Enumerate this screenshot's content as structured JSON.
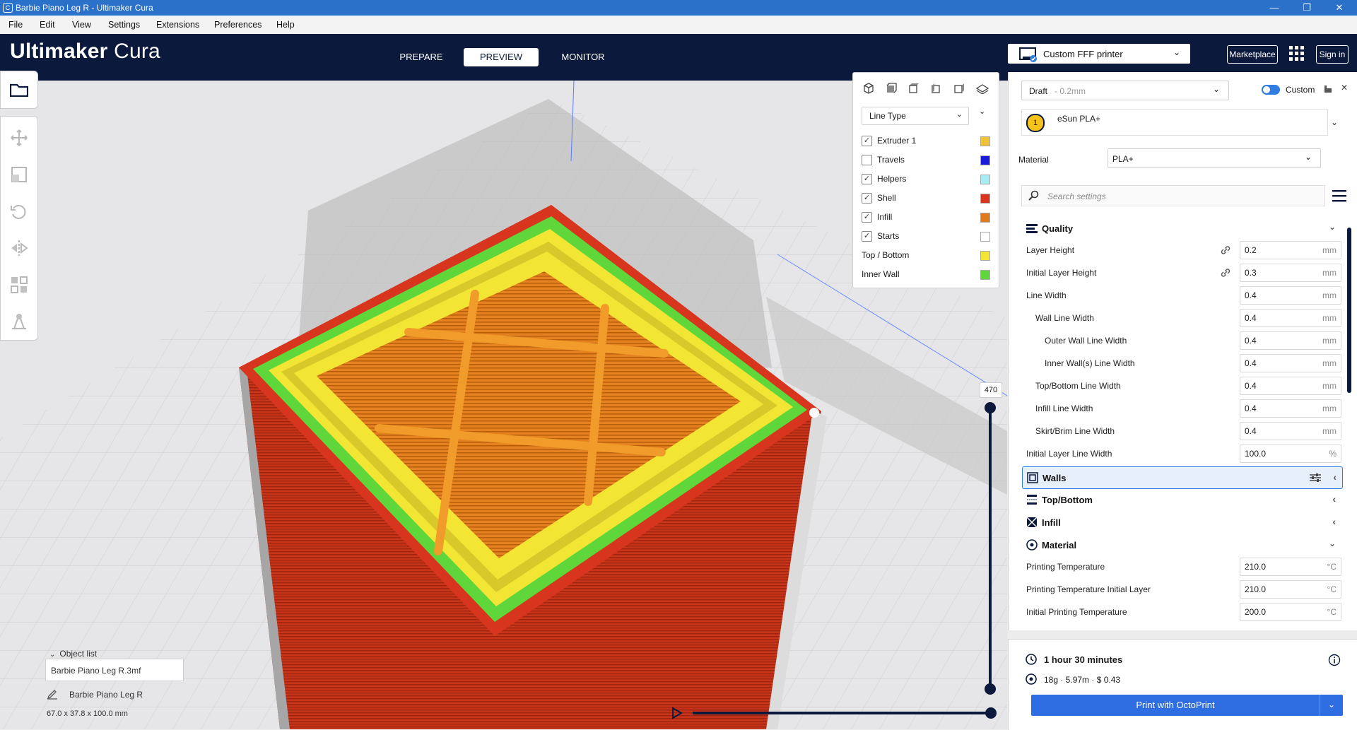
{
  "window": {
    "title": "Barbie Piano Leg R - Ultimaker Cura"
  },
  "menu": [
    "File",
    "Edit",
    "View",
    "Settings",
    "Extensions",
    "Preferences",
    "Help"
  ],
  "header": {
    "logo_bold": "Ultimaker",
    "logo_light": "Cura",
    "stages": [
      "PREPARE",
      "PREVIEW",
      "MONITOR"
    ],
    "active_stage": "PREVIEW",
    "printer": "Custom FFF printer",
    "marketplace": "Marketplace",
    "signin": "Sign in"
  },
  "view_panel": {
    "color_scheme": "Line Type",
    "items": [
      {
        "label": "Extruder 1",
        "checked": true,
        "color": "#f0c23a"
      },
      {
        "label": "Travels",
        "checked": false,
        "color": "#1a1ad8"
      },
      {
        "label": "Helpers",
        "checked": true,
        "color": "#a6ecf2"
      },
      {
        "label": "Shell",
        "checked": true,
        "color": "#d8351e"
      },
      {
        "label": "Infill",
        "checked": true,
        "color": "#e07a1e"
      },
      {
        "label": "Starts",
        "checked": true,
        "color": "#ffffff"
      }
    ],
    "legend": [
      {
        "label": "Top / Bottom",
        "color": "#f2e533"
      },
      {
        "label": "Inner Wall",
        "color": "#5fd63a"
      }
    ]
  },
  "layer": {
    "current": "470"
  },
  "object_list": {
    "toggle": "Object list",
    "file": "Barbie Piano Leg R.3mf",
    "object": "Barbie Piano Leg R",
    "dimensions": "67.0 x 37.8 x 100.0 mm"
  },
  "settings": {
    "profile": "Draft",
    "profile_sub": "0.2mm",
    "custom_label": "Custom",
    "extruder_number": "1",
    "extruder_material": "eSun PLA+",
    "material_label": "Material",
    "material_value": "PLA+",
    "search_placeholder": "Search settings",
    "categories": {
      "quality": "Quality",
      "walls": "Walls",
      "topbottom": "Top/Bottom",
      "infill": "Infill",
      "material": "Material"
    },
    "quality_rows": [
      {
        "label": "Layer Height",
        "value": "0.2",
        "unit": "mm",
        "indent": 0,
        "link": true
      },
      {
        "label": "Initial Layer Height",
        "value": "0.3",
        "unit": "mm",
        "indent": 0,
        "link": true
      },
      {
        "label": "Line Width",
        "value": "0.4",
        "unit": "mm",
        "indent": 0,
        "link": false
      },
      {
        "label": "Wall Line Width",
        "value": "0.4",
        "unit": "mm",
        "indent": 1,
        "link": false
      },
      {
        "label": "Outer Wall Line Width",
        "value": "0.4",
        "unit": "mm",
        "indent": 2,
        "link": false
      },
      {
        "label": "Inner Wall(s) Line Width",
        "value": "0.4",
        "unit": "mm",
        "indent": 2,
        "link": false
      },
      {
        "label": "Top/Bottom Line Width",
        "value": "0.4",
        "unit": "mm",
        "indent": 1,
        "link": false
      },
      {
        "label": "Infill Line Width",
        "value": "0.4",
        "unit": "mm",
        "indent": 1,
        "link": false
      },
      {
        "label": "Skirt/Brim Line Width",
        "value": "0.4",
        "unit": "mm",
        "indent": 1,
        "link": false
      },
      {
        "label": "Initial Layer Line Width",
        "value": "100.0",
        "unit": "%",
        "indent": 0,
        "link": false
      }
    ],
    "material_rows": [
      {
        "label": "Printing Temperature",
        "value": "210.0",
        "unit": "°C"
      },
      {
        "label": "Printing Temperature Initial Layer",
        "value": "210.0",
        "unit": "°C"
      },
      {
        "label": "Initial Printing Temperature",
        "value": "200.0",
        "unit": "°C"
      }
    ]
  },
  "print": {
    "time": "1 hour 30 minutes",
    "usage": "18g · 5.97m · $ 0.43",
    "button": "Print with OctoPrint"
  }
}
